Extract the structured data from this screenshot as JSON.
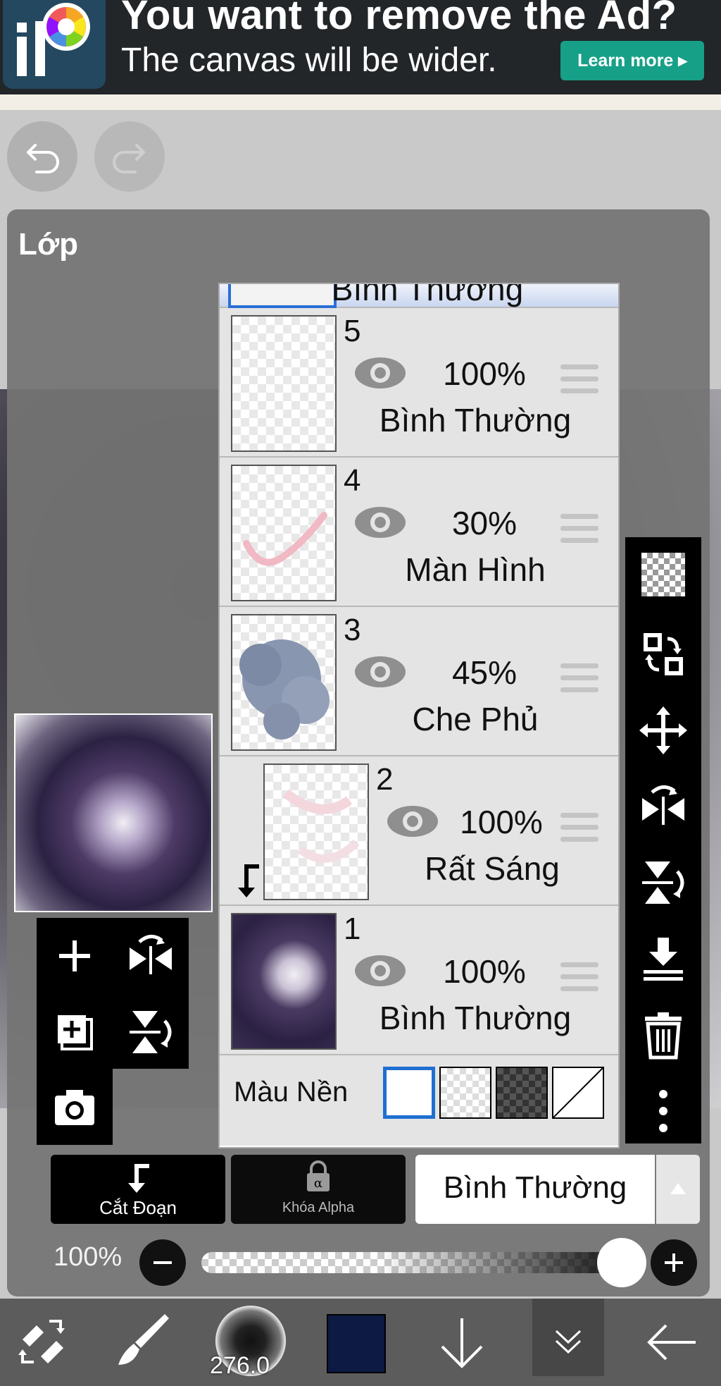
{
  "ad": {
    "title": "You want to remove the Ad?",
    "subtitle": "The canvas will be wider.",
    "learn_more": "Learn more ▸"
  },
  "panel": {
    "title": "Lớp",
    "partial_row_mode": "Bình Thường",
    "layers": [
      {
        "number": "5",
        "opacity": "100%",
        "blend_mode": "Bình Thường"
      },
      {
        "number": "4",
        "opacity": "30%",
        "blend_mode": "Màn Hình"
      },
      {
        "number": "3",
        "opacity": "45%",
        "blend_mode": "Che Phủ"
      },
      {
        "number": "2",
        "opacity": "100%",
        "blend_mode": "Rất Sáng"
      },
      {
        "number": "1",
        "opacity": "100%",
        "blend_mode": "Bình Thường"
      }
    ],
    "background_label": "Màu Nền",
    "clipping_label": "Cắt Đoạn",
    "alpha_lock_label": "Khóa Alpha",
    "blend_mode": "Bình Thường",
    "opacity": "100%"
  },
  "toolbar": {
    "brush_size": "276.0",
    "color": "#0c1a44"
  },
  "colors": {
    "accent": "#1f6fd1",
    "ad_button": "#17a088"
  }
}
